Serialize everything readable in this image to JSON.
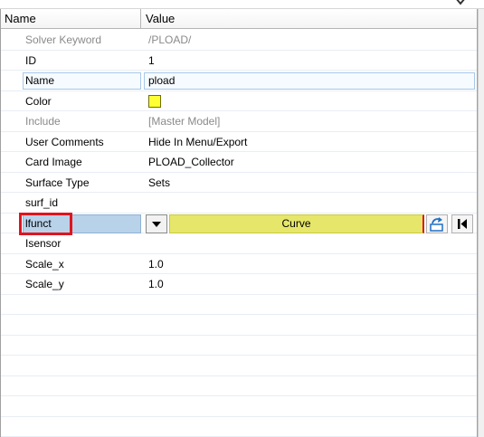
{
  "header": {
    "name_col": "Name",
    "value_col": "Value"
  },
  "rows": [
    {
      "label": "Solver Keyword",
      "value": "/PLOAD/",
      "dim": true
    },
    {
      "label": "ID",
      "value": "1"
    },
    {
      "label": "Name",
      "value": "pload"
    },
    {
      "label": "Color",
      "value": "",
      "swatch": "#ffff33"
    },
    {
      "label": "Include",
      "value": "[Master Model]",
      "dim": true
    },
    {
      "label": "User Comments",
      "value": "Hide In Menu/Export"
    },
    {
      "label": "Card Image",
      "value": "PLOAD_Collector"
    },
    {
      "label": "Surface Type",
      "value": "Sets"
    },
    {
      "label": "surf_id",
      "value": ""
    },
    {
      "label": "lfunct",
      "value": "Curve"
    },
    {
      "label": "Isensor",
      "value": ""
    },
    {
      "label": "Scale_x",
      "value": "1.0"
    },
    {
      "label": "Scale_y",
      "value": "1.0"
    }
  ],
  "colors": {
    "highlight": "#e0141e",
    "curve_field": "#e6e66a",
    "color_swatch": "#ffff33",
    "selected_label": "#b8d2ea"
  },
  "icons": {
    "dropdown": "triangle-down-icon",
    "jump": "jump-to-entity-icon",
    "first": "first-record-icon",
    "collapse": "chevron-down-icon"
  }
}
